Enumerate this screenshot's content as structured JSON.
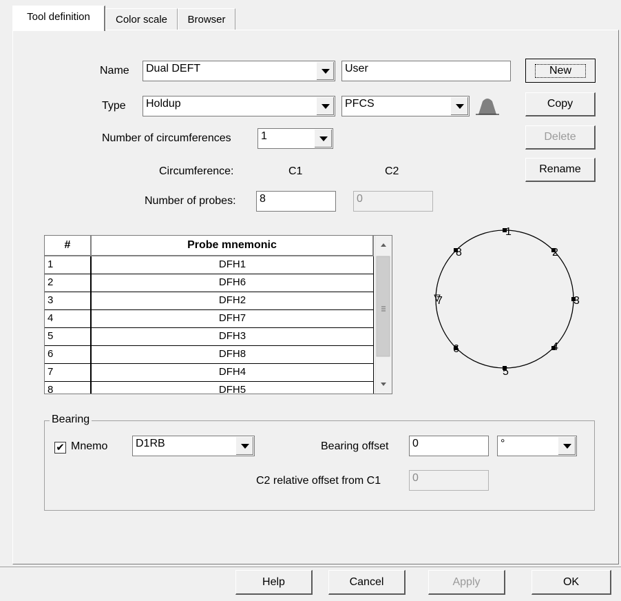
{
  "tabs": [
    {
      "label": "Tool definition",
      "active": true
    },
    {
      "label": "Color scale",
      "active": false
    },
    {
      "label": "Browser",
      "active": false
    }
  ],
  "form": {
    "name_label": "Name",
    "name_value": "Dual DEFT",
    "owner_value": "User",
    "type_label": "Type",
    "type_value": "Holdup",
    "subtype_value": "PFCS",
    "circumferences_label": "Number of circumferences",
    "circumferences_value": "1",
    "circumference_label": "Circumference:",
    "c1_label": "C1",
    "c2_label": "C2",
    "probes_label": "Number of probes:",
    "probes_c1": "8",
    "probes_c2": "0"
  },
  "side_buttons": {
    "new": "New",
    "copy": "Copy",
    "delete": "Delete",
    "rename": "Rename"
  },
  "table": {
    "headers": [
      "#",
      "Probe mnemonic"
    ],
    "rows": [
      {
        "num": "1",
        "mnemonic": "DFH1"
      },
      {
        "num": "2",
        "mnemonic": "DFH6"
      },
      {
        "num": "3",
        "mnemonic": "DFH2"
      },
      {
        "num": "4",
        "mnemonic": "DFH7"
      },
      {
        "num": "5",
        "mnemonic": "DFH3"
      },
      {
        "num": "6",
        "mnemonic": "DFH8"
      },
      {
        "num": "7",
        "mnemonic": "DFH4"
      },
      {
        "num": "8",
        "mnemonic": "DFH5"
      }
    ]
  },
  "diagram": {
    "probe_labels": [
      "1",
      "2",
      "3",
      "4",
      "5",
      "6",
      "7",
      "8"
    ]
  },
  "bearing": {
    "group_title": "Bearing",
    "mnemo_label": "Mnemo",
    "mnemo_checked": true,
    "mnemo_value": "D1RB",
    "offset_label": "Bearing offset",
    "offset_value": "0",
    "unit_value": "°",
    "relative_label": "C2 relative offset from C1",
    "relative_value": "0"
  },
  "footer": {
    "help": "Help",
    "cancel": "Cancel",
    "apply": "Apply",
    "ok": "OK"
  }
}
